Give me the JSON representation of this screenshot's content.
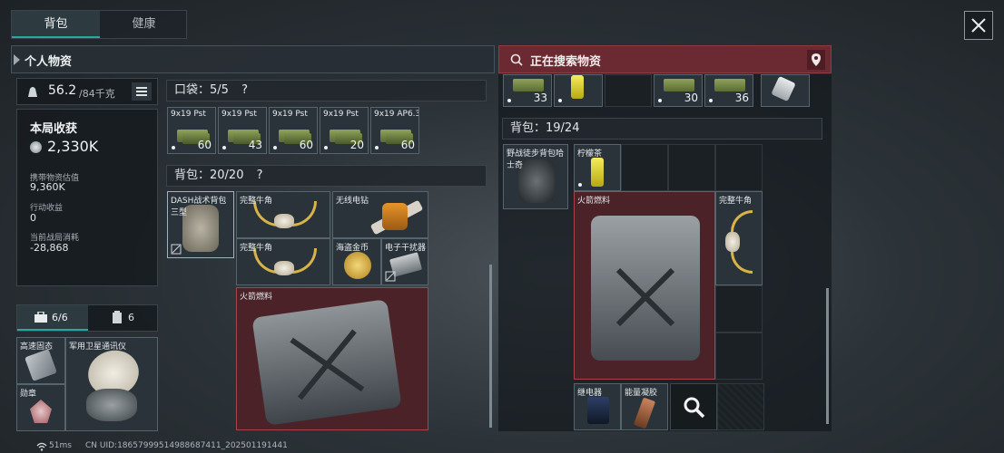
{
  "tabs": {
    "backpack": "背包",
    "health": "健康"
  },
  "left_header": "个人物资",
  "right_header": "正在搜索物资",
  "weight": {
    "value": "56.2",
    "max": "/84千克"
  },
  "stats": {
    "title": "本局收获",
    "value": "2,330K",
    "carry_label": "携带物资估值",
    "carry_value": "9,360K",
    "action_label": "行动收益",
    "action_value": "0",
    "consume_label": "当前战局消耗",
    "consume_value": "-28,868"
  },
  "pocket": {
    "header": "口袋：5/5",
    "help": "?",
    "items": [
      {
        "label": "9x19 Pst",
        "count": "60"
      },
      {
        "label": "9x19 Pst",
        "count": "43"
      },
      {
        "label": "9x19 Pst",
        "count": "60"
      },
      {
        "label": "9x19 Pst",
        "count": "20"
      },
      {
        "label": "9x19 AP6.3",
        "count": "60"
      }
    ]
  },
  "backpack": {
    "header": "背包：20/20",
    "help": "?",
    "items": {
      "bag": "DASH战术背包三型",
      "horn1": "完整牛角",
      "drill": "无线电钻",
      "horn2": "完整牛角",
      "coin": "海盗金币",
      "jammer": "电子干扰器",
      "fuel": "火箭燃料"
    }
  },
  "secure": {
    "tab_count_1": "6/6",
    "tab_count_2": "6",
    "items": {
      "item1": "高速固态",
      "item2": "军用卫星通讯仪",
      "item3": "勋章"
    }
  },
  "search": {
    "top_counts": [
      "33",
      "30",
      "36"
    ],
    "backpack_header": "背包：19/24",
    "items": {
      "bag": "野战徒步背包哈士奇",
      "lemon": "柠檬茶",
      "fuel": "火箭燃料",
      "horn": "完整牛角",
      "relay": "继电器",
      "bar": "能量凝胶"
    }
  },
  "status": {
    "ping": "51ms",
    "uid": "CN UID:18657999514988687411_202501191441"
  },
  "colors": {
    "accent_teal": "#27a9a3",
    "search_red": "#6b2a31",
    "item_red": "#4a2227"
  }
}
